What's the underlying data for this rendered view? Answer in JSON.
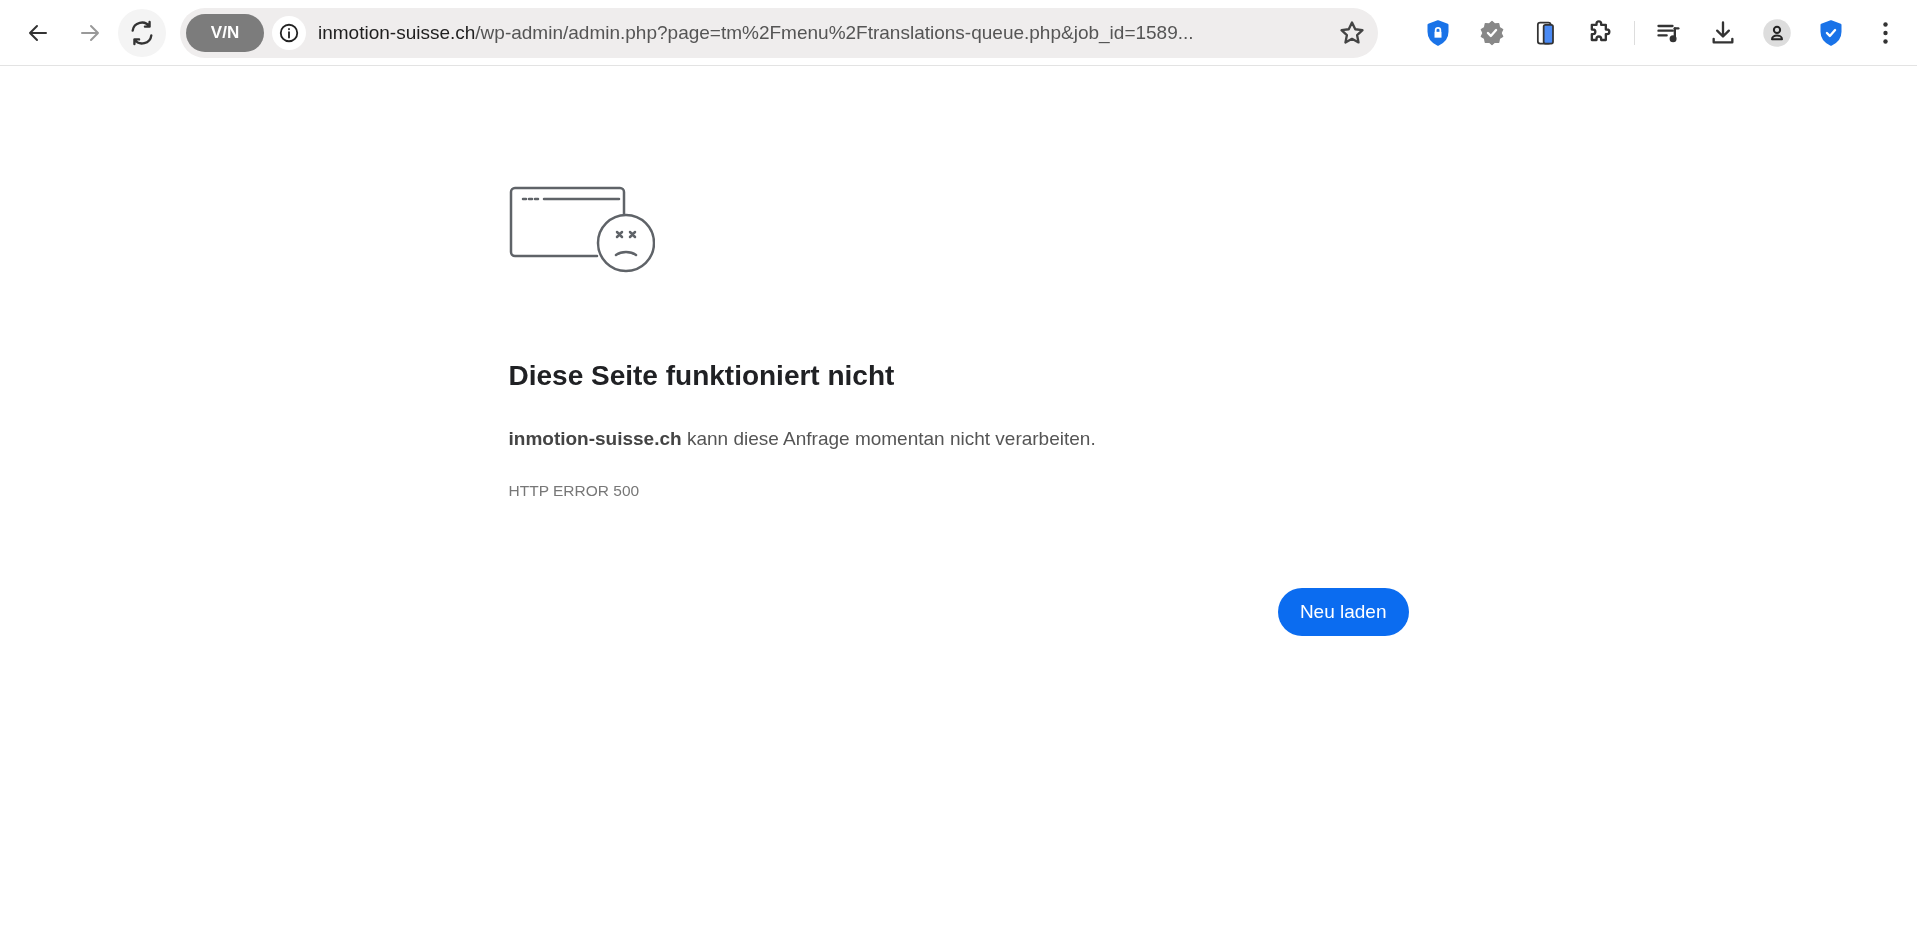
{
  "toolbar": {
    "vpn_badge": "V/N",
    "url_host": "inmotion-suisse.ch",
    "url_path": "/wp-admin/admin.php?page=tm%2Fmenu%2Ftranslations-queue.php&job_id=1589..."
  },
  "error_page": {
    "heading": "Diese Seite funktioniert nicht",
    "message": "**inmotion-suisse.ch** kann diese Anfrage momentan nicht verarbeiten.",
    "error_code": "HTTP ERROR 500",
    "reload_button": "Neu laden"
  }
}
